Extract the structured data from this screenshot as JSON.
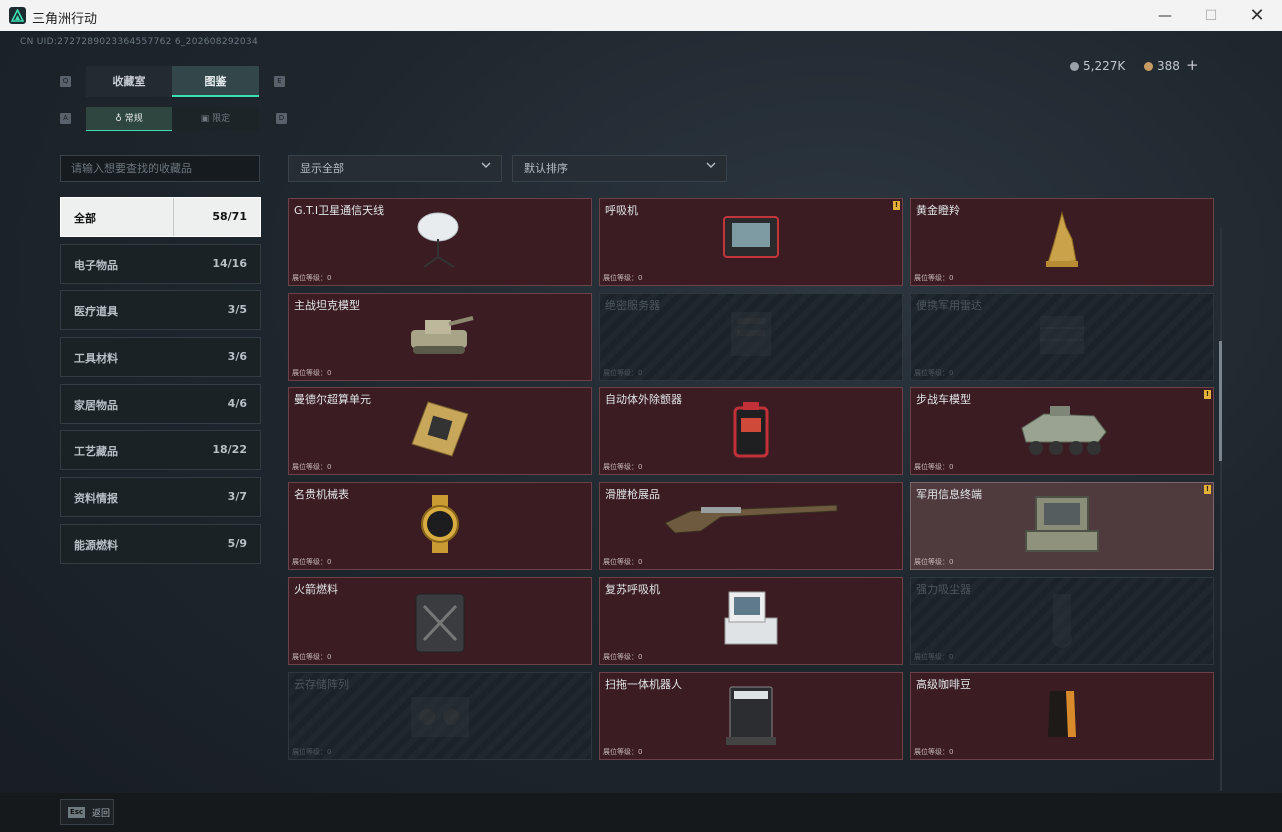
{
  "window": {
    "title": "三角洲行动",
    "minimize": "—",
    "maximize": "☐",
    "close": "✕"
  },
  "header": {
    "uid": "CN UID:2727289023364557762 6_202608292034",
    "currency_1": "5,227K",
    "currency_2": "388",
    "add": "+"
  },
  "tabs": [
    {
      "label": "收藏室",
      "key": "Q"
    },
    {
      "label": "图鉴",
      "key": "E"
    }
  ],
  "subtabs": [
    {
      "label": "常规",
      "key": "A"
    },
    {
      "label": "限定",
      "key": "D"
    }
  ],
  "search": {
    "placeholder": "请输入想要查找的收藏品"
  },
  "filters": {
    "show": "显示全部",
    "sort": "默认排序"
  },
  "categories": [
    {
      "label": "全部",
      "count": "58/71"
    },
    {
      "label": "电子物品",
      "count": "14/16"
    },
    {
      "label": "医疗道具",
      "count": "3/5"
    },
    {
      "label": "工具材料",
      "count": "3/6"
    },
    {
      "label": "家居物品",
      "count": "4/6"
    },
    {
      "label": "工艺藏品",
      "count": "18/22"
    },
    {
      "label": "资料情报",
      "count": "3/7"
    },
    {
      "label": "能源燃料",
      "count": "5/9"
    }
  ],
  "level_label": "展位等级：0",
  "items": [
    {
      "name": "G.T.I卫星通信天线",
      "state": "owned",
      "badge": ""
    },
    {
      "name": "呼吸机",
      "state": "owned",
      "badge": "!"
    },
    {
      "name": "黄金瞪羚",
      "state": "owned",
      "badge": ""
    },
    {
      "name": "主战坦克模型",
      "state": "owned",
      "badge": ""
    },
    {
      "name": "绝密服务器",
      "state": "locked",
      "badge": ""
    },
    {
      "name": "便携军用雷达",
      "state": "locked",
      "badge": ""
    },
    {
      "name": "曼德尔超算单元",
      "state": "owned",
      "badge": ""
    },
    {
      "name": "自动体外除颤器",
      "state": "owned",
      "badge": ""
    },
    {
      "name": "步战车模型",
      "state": "owned",
      "badge": "!"
    },
    {
      "name": "名贵机械表",
      "state": "owned",
      "badge": ""
    },
    {
      "name": "滑膛枪展品",
      "state": "owned",
      "badge": ""
    },
    {
      "name": "军用信息终端",
      "state": "highlight",
      "badge": "!"
    },
    {
      "name": "火箭燃料",
      "state": "owned",
      "badge": ""
    },
    {
      "name": "复苏呼吸机",
      "state": "owned",
      "badge": ""
    },
    {
      "name": "强力吸尘器",
      "state": "locked",
      "badge": ""
    },
    {
      "name": "云存储阵列",
      "state": "locked",
      "badge": ""
    },
    {
      "name": "扫拖一体机器人",
      "state": "owned",
      "badge": ""
    },
    {
      "name": "高级咖啡豆",
      "state": "owned",
      "badge": ""
    }
  ],
  "footer": {
    "key": "Esc",
    "label": "返回"
  }
}
